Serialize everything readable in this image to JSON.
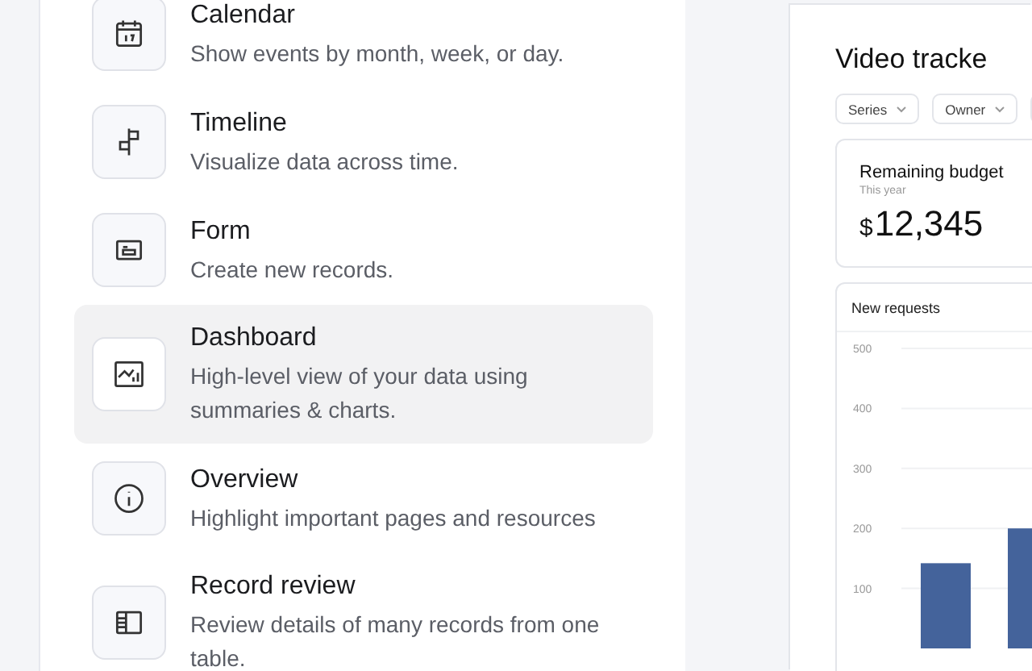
{
  "layouts": [
    {
      "kind": "calendar",
      "title": "Calendar",
      "description": "Show events by month, week, or day.",
      "selected": false
    },
    {
      "kind": "timeline",
      "title": "Timeline",
      "description": "Visualize data across time.",
      "selected": false
    },
    {
      "kind": "form",
      "title": "Form",
      "description": "Create new records.",
      "selected": false
    },
    {
      "kind": "dashboard",
      "title": "Dashboard",
      "description": "High-level view of your data using summaries & charts.",
      "selected": true
    },
    {
      "kind": "overview",
      "title": "Overview",
      "description": "Highlight important pages and resources",
      "selected": false
    },
    {
      "kind": "record_review",
      "title": "Record review",
      "description": "Review details of many records from one table.",
      "selected": false
    }
  ],
  "preview": {
    "title": "Video tracke",
    "filters": [
      {
        "label": "Series"
      },
      {
        "label": "Owner"
      }
    ],
    "budget": {
      "label": "Remaining budget",
      "period": "This year",
      "currency": "$",
      "amount": "12,345"
    },
    "chart": {
      "title": "New requests",
      "chart_data": {
        "type": "bar",
        "grid": true,
        "ylim": [
          0,
          500
        ],
        "yticks": [
          100,
          200,
          300,
          400,
          500
        ],
        "values": [
          142,
          200
        ]
      }
    }
  }
}
